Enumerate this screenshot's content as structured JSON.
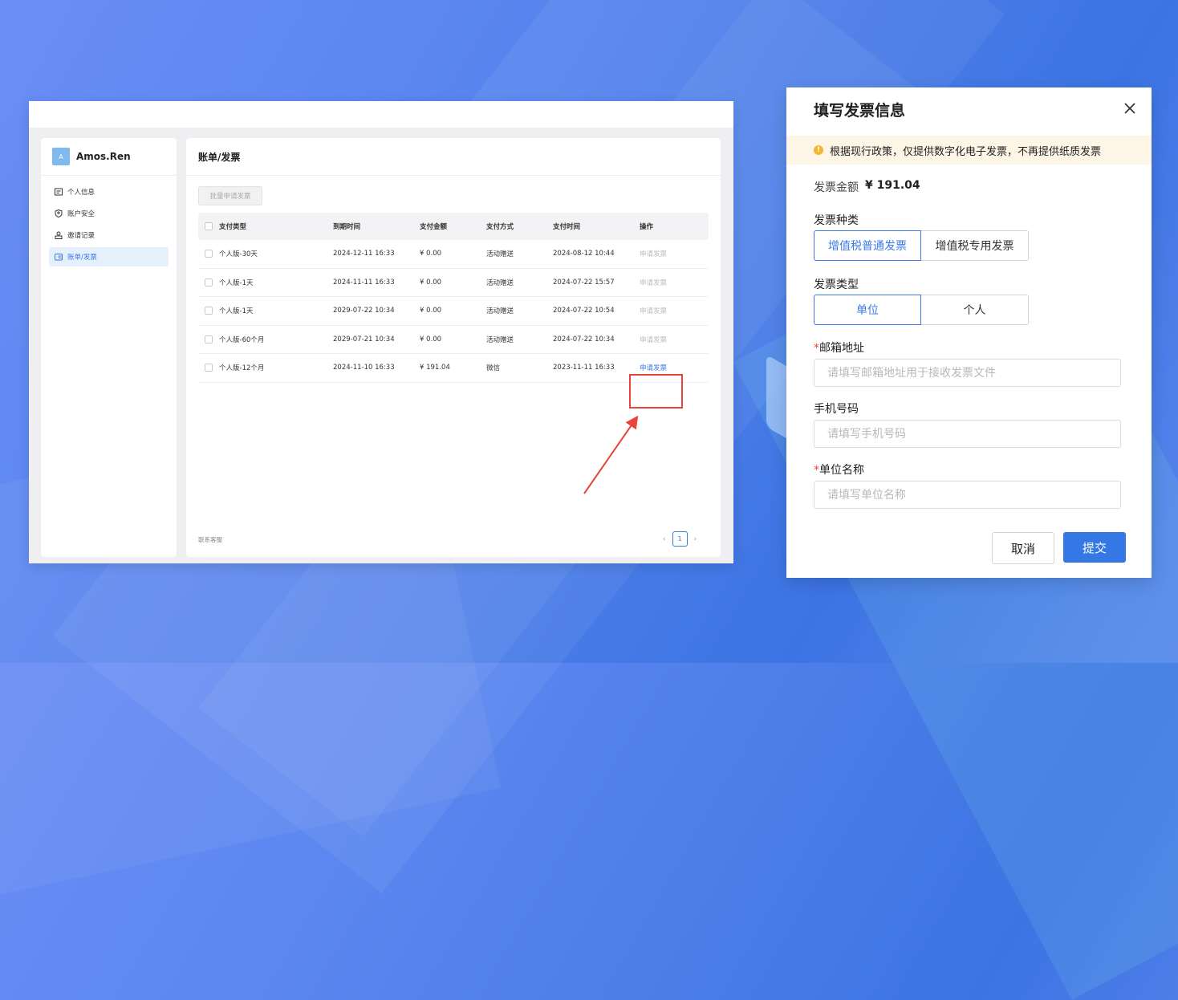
{
  "app": {
    "username": "Amos.Ren",
    "avatar_letter": "A",
    "sidebar": [
      {
        "label": "个人信息",
        "icon": "profile-card-icon",
        "active": false
      },
      {
        "label": "账户安全",
        "icon": "shield-user-icon",
        "active": false
      },
      {
        "label": "邀请记录",
        "icon": "invite-user-icon",
        "active": false
      },
      {
        "label": "账单/发票",
        "icon": "wallet-icon",
        "active": true
      }
    ],
    "page_title": "账单/发票",
    "batch_button": "批量申请发票",
    "table": {
      "headers": [
        "支付类型",
        "到期时间",
        "支付金额",
        "支付方式",
        "支付时间",
        "操作"
      ],
      "rows": [
        {
          "type": "个人版-30天",
          "expire": "2024-12-11 16:33",
          "amount": "¥ 0.00",
          "method": "活动赠送",
          "paid": "2024-08-12 10:44",
          "op": "申请发票",
          "enabled": false
        },
        {
          "type": "个人版-1天",
          "expire": "2024-11-11 16:33",
          "amount": "¥ 0.00",
          "method": "活动赠送",
          "paid": "2024-07-22 15:57",
          "op": "申请发票",
          "enabled": false
        },
        {
          "type": "个人版-1天",
          "expire": "2029-07-22 10:34",
          "amount": "¥ 0.00",
          "method": "活动赠送",
          "paid": "2024-07-22 10:54",
          "op": "申请发票",
          "enabled": false
        },
        {
          "type": "个人版-60个月",
          "expire": "2029-07-21 10:34",
          "amount": "¥ 0.00",
          "method": "活动赠送",
          "paid": "2024-07-22 10:34",
          "op": "申请发票",
          "enabled": false
        },
        {
          "type": "个人版-12个月",
          "expire": "2024-11-10 16:33",
          "amount": "¥ 191.04",
          "method": "微信",
          "paid": "2023-11-11 16:33",
          "op": "申请发票",
          "enabled": true
        }
      ]
    },
    "contact": "联系客服",
    "pager": {
      "current": "1"
    }
  },
  "dialog": {
    "title": "填写发票信息",
    "notice": "根据现行政策，仅提供数字化电子发票，不再提供纸质发票",
    "amount_label": "发票金额",
    "amount_value": "¥ 191.04",
    "invoice_kind_label": "发票种类",
    "invoice_kind_options": [
      "增值税普通发票",
      "增值税专用发票"
    ],
    "invoice_type_label": "发票类型",
    "invoice_type_options": [
      "单位",
      "个人"
    ],
    "email_label": "邮箱地址",
    "email_placeholder": "请填写邮箱地址用于接收发票文件",
    "phone_label": "手机号码",
    "phone_placeholder": "请填写手机号码",
    "company_label": "单位名称",
    "company_placeholder": "请填写单位名称",
    "required_mark": "*",
    "cancel": "取消",
    "submit": "提交"
  },
  "colors": {
    "accent": "#3578e5",
    "highlight": "#e8443a",
    "warning": "#f2b534"
  }
}
